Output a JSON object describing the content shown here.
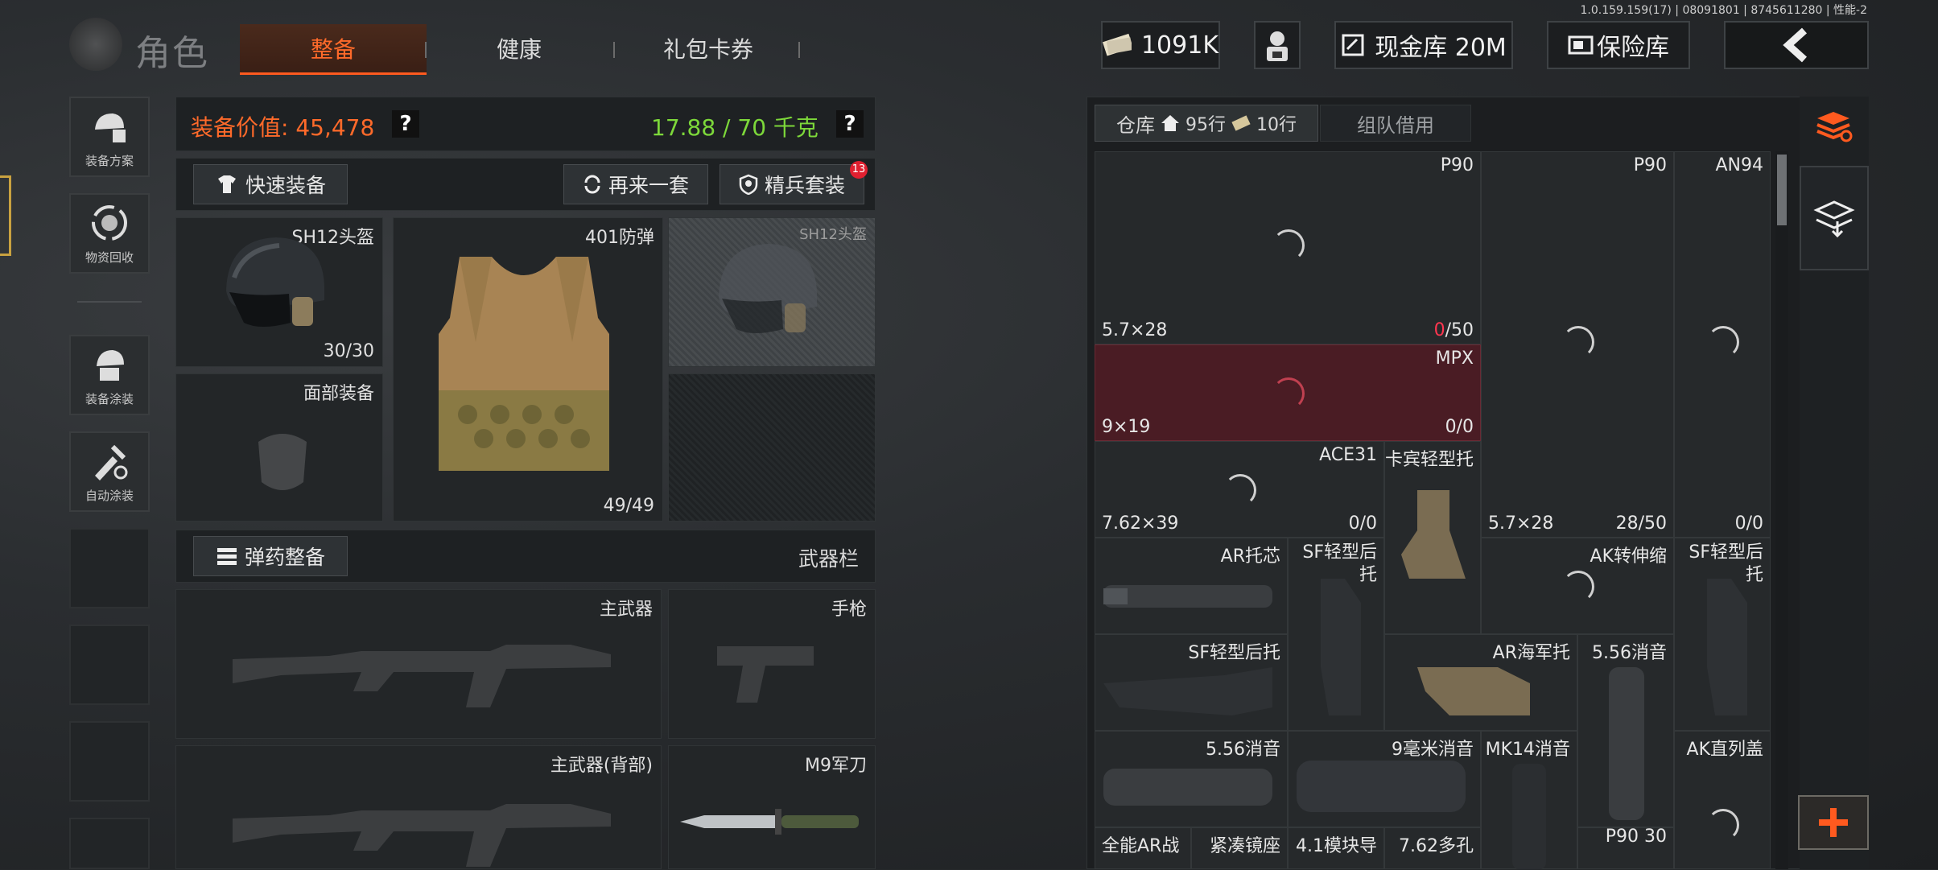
{
  "version_text": "1.0.159.159(17) | 08091801 | 8745611280 | 性能-2",
  "header": {
    "title": "角色",
    "tabs": [
      "整备",
      "健康",
      "礼包卡券"
    ],
    "currency": "1091K",
    "cash_vault": "现金库 20M",
    "safe_box": "保险库"
  },
  "sidebar": {
    "items": [
      {
        "label": "装备方案",
        "icon": "equipment-plan-icon"
      },
      {
        "label": "物资回收",
        "icon": "recycle-icon"
      },
      {
        "label": "装备涂装",
        "icon": "paint-skin-icon"
      },
      {
        "label": "自动涂装",
        "icon": "auto-paint-icon"
      }
    ]
  },
  "loadout": {
    "value_label": "装备价值: 45,478",
    "weight": "17.88 / 70 千克",
    "help": "?",
    "quick_equip": "快速装备",
    "redo": "再来一套",
    "elite_set": "精兵套装",
    "elite_badge": "13",
    "helmet": {
      "name": "SH12头盔",
      "durability": "30/30"
    },
    "armor": {
      "name": "401防弹",
      "durability": "49/49"
    },
    "ghost_helmet": {
      "name": "SH12头盔"
    },
    "face": {
      "name": "面部装备"
    },
    "ammo_btn": "弹药整备",
    "weapon_bar": "武器栏",
    "primary": "主武器",
    "pistol": "手枪",
    "primary_back": "主武器(背部)",
    "knife": "M9军刀"
  },
  "inventory": {
    "tab_storage": "仓库",
    "rows_label": "95行",
    "rows2_label": "10行",
    "tab_team": "组队借用",
    "cells": {
      "p90_1": {
        "name": "P90",
        "cal": "5.7×28",
        "cnt_red": "0",
        "cnt_rest": "/50"
      },
      "p90_2": {
        "name": "P90"
      },
      "an94": {
        "name": "AN94"
      },
      "mpx": {
        "name": "MPX",
        "cal": "9×19",
        "cnt": "0/0"
      },
      "ace31": {
        "name": "ACE31",
        "cal": "7.62×39",
        "cnt": "0/0"
      },
      "carbine_stock": {
        "name": "卡宾轻型托"
      },
      "p90_cal": {
        "cal": "5.7×28",
        "cnt": "28/50"
      },
      "an94_cnt": {
        "cnt": "0/0"
      },
      "ar_core": {
        "name": "AR托芯"
      },
      "sf_rear_1": {
        "name": "SF轻型后托"
      },
      "ak_fold": {
        "name": "AK转伸缩"
      },
      "sf_rear_2": {
        "name": "SF轻型后托"
      },
      "sf_light": {
        "name": "SF轻型后托"
      },
      "ar_navy": {
        "name": "AR海军托"
      },
      "sup556_a": {
        "name": "5.56消音"
      },
      "sup556_b": {
        "name": "5.56消音"
      },
      "sup9": {
        "name": "9毫米消音"
      },
      "mk14": {
        "name": "MK14消音"
      },
      "ak_cover": {
        "name": "AK直列盖"
      },
      "row_bottom": [
        "全能AR战",
        "紧凑镜座",
        "4.1模块导",
        "7.62多孔",
        "P90 30"
      ]
    }
  },
  "colors": {
    "accent": "#ff5a1f",
    "value": "#ff6a2a",
    "weight": "#7dd83a",
    "alert": "#ff3650"
  }
}
